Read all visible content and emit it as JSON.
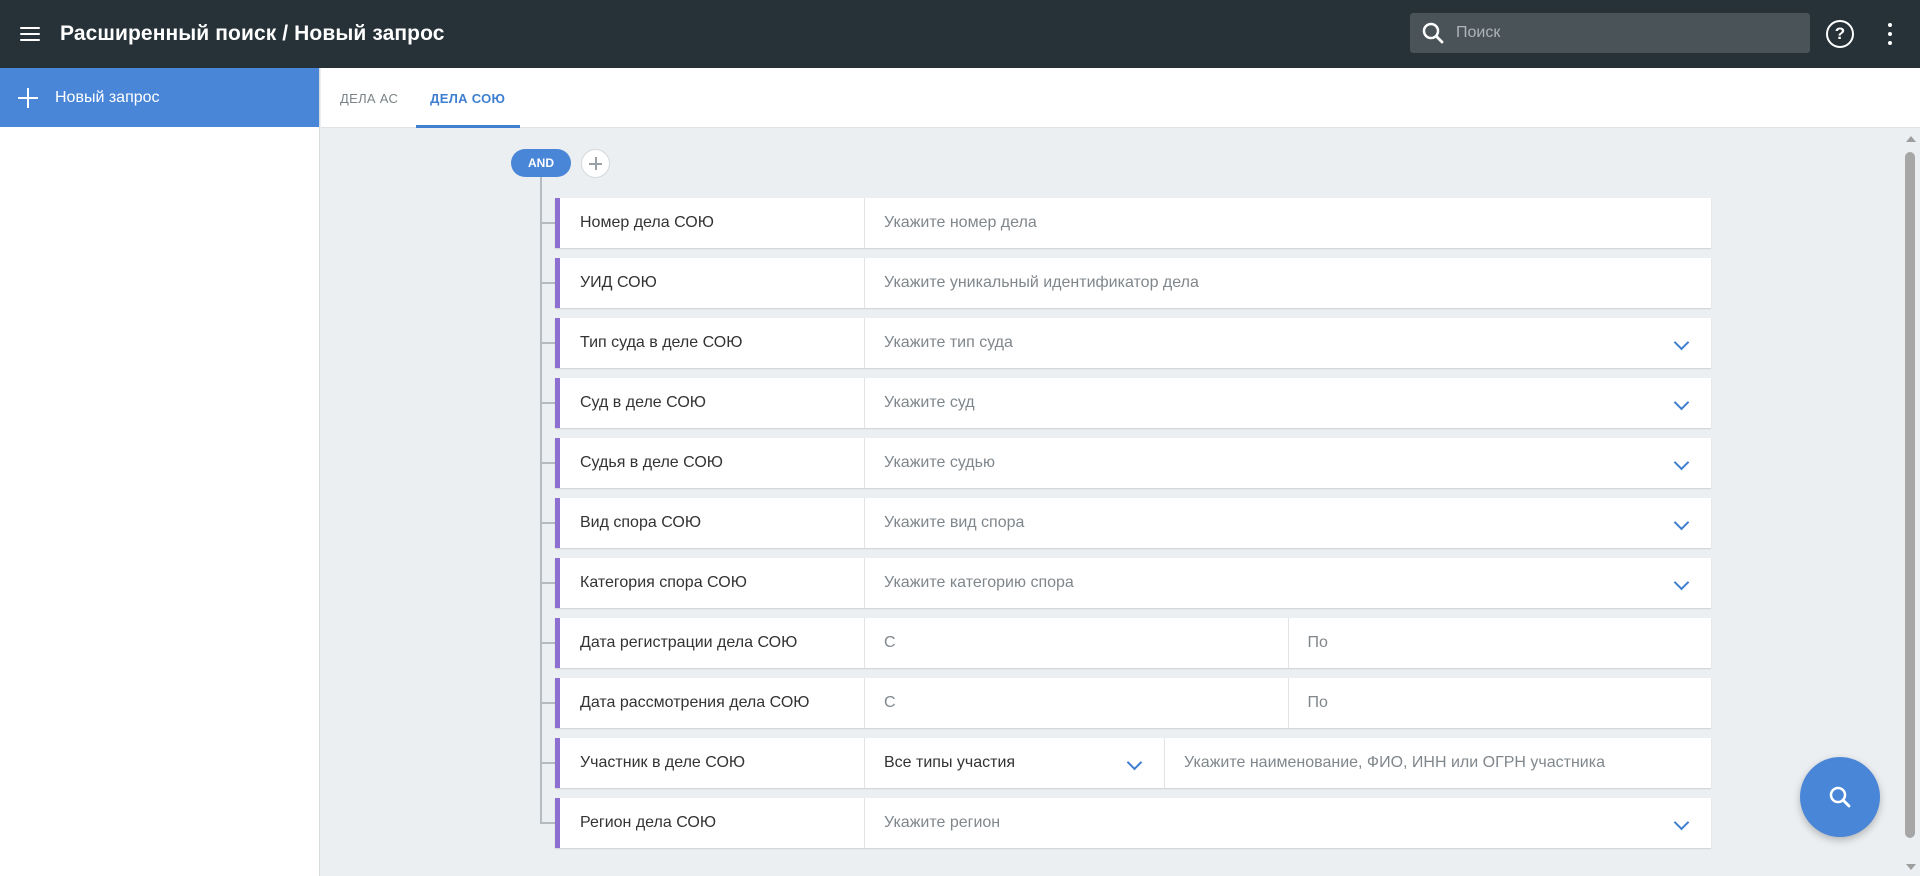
{
  "header": {
    "title": "Расширенный поиск / Новый запрос",
    "search_placeholder": "Поиск",
    "help_icon": "help-circle-icon",
    "menu_icon": "hamburger-menu-icon",
    "more_icon": "more-vertical-icon"
  },
  "sidebar": {
    "new_query_label": "Новый запрос"
  },
  "tabs": [
    {
      "label": "ДЕЛА АС",
      "active": false
    },
    {
      "label": "ДЕЛА СОЮ",
      "active": true
    }
  ],
  "builder": {
    "operator": "AND",
    "rules": [
      {
        "label": "Номер дела СОЮ",
        "placeholder": "Укажите номер дела"
      },
      {
        "label": "УИД СОЮ",
        "placeholder": "Укажите уникальный идентификатор дела"
      },
      {
        "label": "Тип суда в деле СОЮ",
        "placeholder": "Укажите тип суда"
      },
      {
        "label": "Суд в деле СОЮ",
        "placeholder": "Укажите суд"
      },
      {
        "label": "Судья в деле СОЮ",
        "placeholder": "Укажите судью"
      },
      {
        "label": "Вид спора СОЮ",
        "placeholder": "Укажите вид спора"
      },
      {
        "label": "Категория спора СОЮ",
        "placeholder": "Укажите категорию спора"
      },
      {
        "label": "Дата регистрации дела СОЮ",
        "from_placeholder": "С",
        "to_placeholder": "По"
      },
      {
        "label": "Дата рассмотрения дела СОЮ",
        "from_placeholder": "С",
        "to_placeholder": "По"
      },
      {
        "label": "Участник в деле СОЮ",
        "type_value": "Все типы участия",
        "placeholder": "Укажите наименование, ФИО, ИНН или ОГРН участника"
      },
      {
        "label": "Регион дела СОЮ",
        "placeholder": "Укажите регион"
      }
    ]
  },
  "colors": {
    "topbar": "#263238",
    "accent": "#4a86d8",
    "rule_border": "#8c6fd1",
    "background": "#eceff1"
  }
}
